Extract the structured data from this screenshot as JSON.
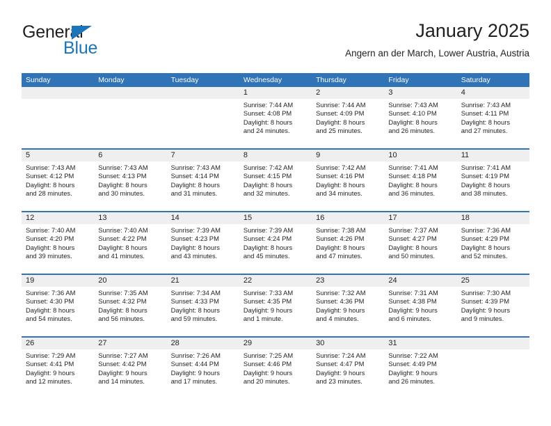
{
  "logo": {
    "word_one": "General",
    "word_two": "Blue",
    "triangle_color": "#1b75bb"
  },
  "header": {
    "title": "January 2025",
    "subtitle": "Angern an der March, Lower Austria, Austria",
    "accent_color": "#3073b7",
    "band_color": "#efefef"
  },
  "weekdays": [
    "Sunday",
    "Monday",
    "Tuesday",
    "Wednesday",
    "Thursday",
    "Friday",
    "Saturday"
  ],
  "weeks": [
    [
      {
        "day": "",
        "sunrise": "",
        "sunset": "",
        "daylight1": "",
        "daylight2": ""
      },
      {
        "day": "",
        "sunrise": "",
        "sunset": "",
        "daylight1": "",
        "daylight2": ""
      },
      {
        "day": "",
        "sunrise": "",
        "sunset": "",
        "daylight1": "",
        "daylight2": ""
      },
      {
        "day": "1",
        "sunrise": "Sunrise: 7:44 AM",
        "sunset": "Sunset: 4:08 PM",
        "daylight1": "Daylight: 8 hours",
        "daylight2": "and 24 minutes."
      },
      {
        "day": "2",
        "sunrise": "Sunrise: 7:44 AM",
        "sunset": "Sunset: 4:09 PM",
        "daylight1": "Daylight: 8 hours",
        "daylight2": "and 25 minutes."
      },
      {
        "day": "3",
        "sunrise": "Sunrise: 7:43 AM",
        "sunset": "Sunset: 4:10 PM",
        "daylight1": "Daylight: 8 hours",
        "daylight2": "and 26 minutes."
      },
      {
        "day": "4",
        "sunrise": "Sunrise: 7:43 AM",
        "sunset": "Sunset: 4:11 PM",
        "daylight1": "Daylight: 8 hours",
        "daylight2": "and 27 minutes."
      }
    ],
    [
      {
        "day": "5",
        "sunrise": "Sunrise: 7:43 AM",
        "sunset": "Sunset: 4:12 PM",
        "daylight1": "Daylight: 8 hours",
        "daylight2": "and 28 minutes."
      },
      {
        "day": "6",
        "sunrise": "Sunrise: 7:43 AM",
        "sunset": "Sunset: 4:13 PM",
        "daylight1": "Daylight: 8 hours",
        "daylight2": "and 30 minutes."
      },
      {
        "day": "7",
        "sunrise": "Sunrise: 7:43 AM",
        "sunset": "Sunset: 4:14 PM",
        "daylight1": "Daylight: 8 hours",
        "daylight2": "and 31 minutes."
      },
      {
        "day": "8",
        "sunrise": "Sunrise: 7:42 AM",
        "sunset": "Sunset: 4:15 PM",
        "daylight1": "Daylight: 8 hours",
        "daylight2": "and 32 minutes."
      },
      {
        "day": "9",
        "sunrise": "Sunrise: 7:42 AM",
        "sunset": "Sunset: 4:16 PM",
        "daylight1": "Daylight: 8 hours",
        "daylight2": "and 34 minutes."
      },
      {
        "day": "10",
        "sunrise": "Sunrise: 7:41 AM",
        "sunset": "Sunset: 4:18 PM",
        "daylight1": "Daylight: 8 hours",
        "daylight2": "and 36 minutes."
      },
      {
        "day": "11",
        "sunrise": "Sunrise: 7:41 AM",
        "sunset": "Sunset: 4:19 PM",
        "daylight1": "Daylight: 8 hours",
        "daylight2": "and 38 minutes."
      }
    ],
    [
      {
        "day": "12",
        "sunrise": "Sunrise: 7:40 AM",
        "sunset": "Sunset: 4:20 PM",
        "daylight1": "Daylight: 8 hours",
        "daylight2": "and 39 minutes."
      },
      {
        "day": "13",
        "sunrise": "Sunrise: 7:40 AM",
        "sunset": "Sunset: 4:22 PM",
        "daylight1": "Daylight: 8 hours",
        "daylight2": "and 41 minutes."
      },
      {
        "day": "14",
        "sunrise": "Sunrise: 7:39 AM",
        "sunset": "Sunset: 4:23 PM",
        "daylight1": "Daylight: 8 hours",
        "daylight2": "and 43 minutes."
      },
      {
        "day": "15",
        "sunrise": "Sunrise: 7:39 AM",
        "sunset": "Sunset: 4:24 PM",
        "daylight1": "Daylight: 8 hours",
        "daylight2": "and 45 minutes."
      },
      {
        "day": "16",
        "sunrise": "Sunrise: 7:38 AM",
        "sunset": "Sunset: 4:26 PM",
        "daylight1": "Daylight: 8 hours",
        "daylight2": "and 47 minutes."
      },
      {
        "day": "17",
        "sunrise": "Sunrise: 7:37 AM",
        "sunset": "Sunset: 4:27 PM",
        "daylight1": "Daylight: 8 hours",
        "daylight2": "and 50 minutes."
      },
      {
        "day": "18",
        "sunrise": "Sunrise: 7:36 AM",
        "sunset": "Sunset: 4:29 PM",
        "daylight1": "Daylight: 8 hours",
        "daylight2": "and 52 minutes."
      }
    ],
    [
      {
        "day": "19",
        "sunrise": "Sunrise: 7:36 AM",
        "sunset": "Sunset: 4:30 PM",
        "daylight1": "Daylight: 8 hours",
        "daylight2": "and 54 minutes."
      },
      {
        "day": "20",
        "sunrise": "Sunrise: 7:35 AM",
        "sunset": "Sunset: 4:32 PM",
        "daylight1": "Daylight: 8 hours",
        "daylight2": "and 56 minutes."
      },
      {
        "day": "21",
        "sunrise": "Sunrise: 7:34 AM",
        "sunset": "Sunset: 4:33 PM",
        "daylight1": "Daylight: 8 hours",
        "daylight2": "and 59 minutes."
      },
      {
        "day": "22",
        "sunrise": "Sunrise: 7:33 AM",
        "sunset": "Sunset: 4:35 PM",
        "daylight1": "Daylight: 9 hours",
        "daylight2": "and 1 minute."
      },
      {
        "day": "23",
        "sunrise": "Sunrise: 7:32 AM",
        "sunset": "Sunset: 4:36 PM",
        "daylight1": "Daylight: 9 hours",
        "daylight2": "and 4 minutes."
      },
      {
        "day": "24",
        "sunrise": "Sunrise: 7:31 AM",
        "sunset": "Sunset: 4:38 PM",
        "daylight1": "Daylight: 9 hours",
        "daylight2": "and 6 minutes."
      },
      {
        "day": "25",
        "sunrise": "Sunrise: 7:30 AM",
        "sunset": "Sunset: 4:39 PM",
        "daylight1": "Daylight: 9 hours",
        "daylight2": "and 9 minutes."
      }
    ],
    [
      {
        "day": "26",
        "sunrise": "Sunrise: 7:29 AM",
        "sunset": "Sunset: 4:41 PM",
        "daylight1": "Daylight: 9 hours",
        "daylight2": "and 12 minutes."
      },
      {
        "day": "27",
        "sunrise": "Sunrise: 7:27 AM",
        "sunset": "Sunset: 4:42 PM",
        "daylight1": "Daylight: 9 hours",
        "daylight2": "and 14 minutes."
      },
      {
        "day": "28",
        "sunrise": "Sunrise: 7:26 AM",
        "sunset": "Sunset: 4:44 PM",
        "daylight1": "Daylight: 9 hours",
        "daylight2": "and 17 minutes."
      },
      {
        "day": "29",
        "sunrise": "Sunrise: 7:25 AM",
        "sunset": "Sunset: 4:46 PM",
        "daylight1": "Daylight: 9 hours",
        "daylight2": "and 20 minutes."
      },
      {
        "day": "30",
        "sunrise": "Sunrise: 7:24 AM",
        "sunset": "Sunset: 4:47 PM",
        "daylight1": "Daylight: 9 hours",
        "daylight2": "and 23 minutes."
      },
      {
        "day": "31",
        "sunrise": "Sunrise: 7:22 AM",
        "sunset": "Sunset: 4:49 PM",
        "daylight1": "Daylight: 9 hours",
        "daylight2": "and 26 minutes."
      },
      {
        "day": "",
        "sunrise": "",
        "sunset": "",
        "daylight1": "",
        "daylight2": ""
      }
    ]
  ]
}
